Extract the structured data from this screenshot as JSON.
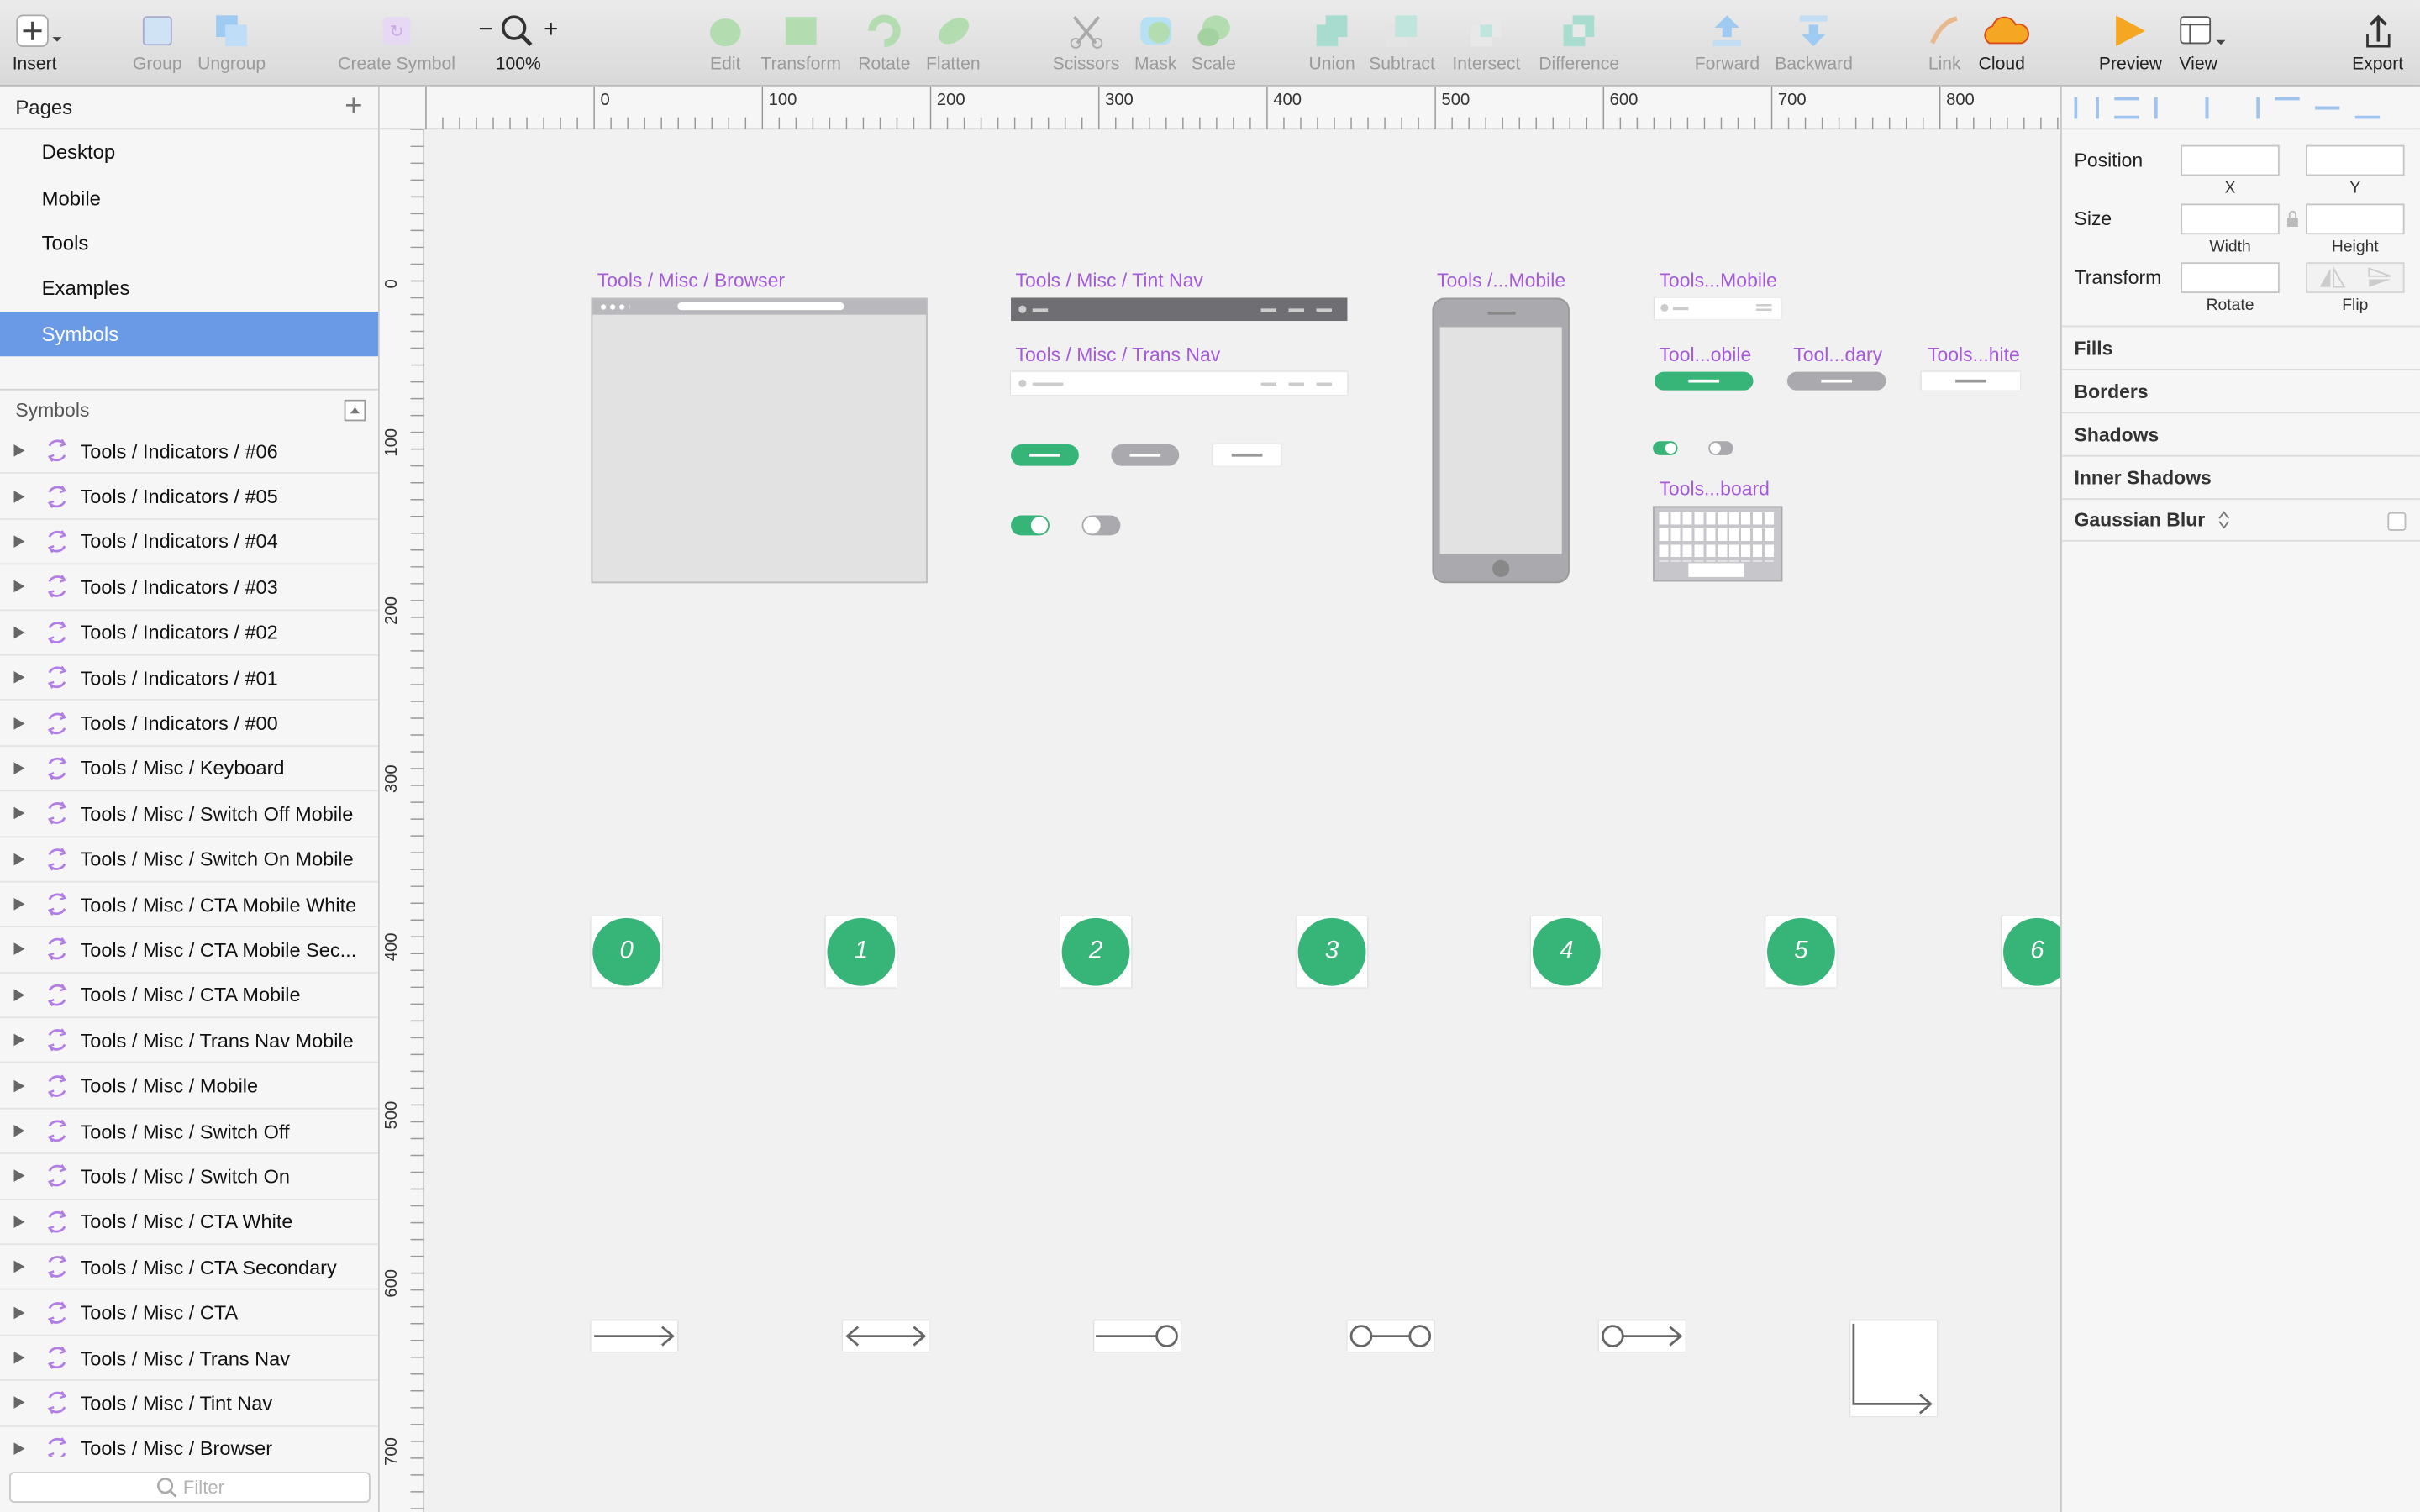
{
  "toolbar": {
    "insert": "Insert",
    "group": "Group",
    "ungroup": "Ungroup",
    "create_symbol": "Create Symbol",
    "zoom_minus": "−",
    "zoom_plus": "+",
    "zoom": "100%",
    "edit": "Edit",
    "transform": "Transform",
    "rotate": "Rotate",
    "flatten": "Flatten",
    "scissors": "Scissors",
    "mask": "Mask",
    "scale": "Scale",
    "union": "Union",
    "subtract": "Subtract",
    "intersect": "Intersect",
    "difference": "Difference",
    "forward": "Forward",
    "backward": "Backward",
    "link": "Link",
    "cloud": "Cloud",
    "preview": "Preview",
    "view": "View",
    "export": "Export"
  },
  "pages": {
    "title": "Pages",
    "add": "+",
    "items": [
      "Desktop",
      "Mobile",
      "Tools",
      "Examples",
      "Symbols"
    ],
    "selected": "Symbols"
  },
  "symbols_panel": {
    "title": "Symbols",
    "items": [
      "Tools / Indicators / #06",
      "Tools / Indicators / #05",
      "Tools / Indicators / #04",
      "Tools / Indicators / #03",
      "Tools / Indicators / #02",
      "Tools / Indicators / #01",
      "Tools / Indicators / #00",
      "Tools / Misc / Keyboard",
      "Tools / Misc / Switch Off Mobile",
      "Tools / Misc / Switch On Mobile",
      "Tools / Misc / CTA Mobile White",
      "Tools / Misc / CTA Mobile Sec...",
      "Tools / Misc / CTA Mobile",
      "Tools / Misc / Trans Nav Mobile",
      "Tools / Misc / Mobile",
      "Tools / Misc / Switch Off",
      "Tools / Misc / Switch On",
      "Tools / Misc / CTA White",
      "Tools / Misc / CTA Secondary",
      "Tools / Misc / CTA",
      "Tools / Misc / Trans Nav",
      "Tools / Misc / Tint Nav",
      "Tools / Misc / Browser"
    ],
    "filter_placeholder": "Filter"
  },
  "rulers": {
    "horizontal": [
      "0",
      "100",
      "200",
      "300",
      "400",
      "500",
      "600",
      "700",
      "800"
    ],
    "vertical": [
      "0",
      "100",
      "200",
      "300",
      "400",
      "500",
      "600",
      "700"
    ]
  },
  "canvas": {
    "artboards": {
      "browser": "Tools / Misc / Browser",
      "tint_nav": "Tools / Misc / Tint Nav",
      "trans_nav": "Tools / Misc / Trans Nav",
      "mobile": "Tools /...Mobile",
      "trans_nav_mobile": "Tools...Mobile",
      "cta_mobile": "Tool...obile",
      "cta_mobile_secondary": "Tool...dary",
      "cta_mobile_white": "Tools...hite",
      "keyboard": "Tools...board"
    },
    "indicators": [
      "0",
      "1",
      "2",
      "3",
      "4",
      "5",
      "6"
    ]
  },
  "inspector": {
    "position": "Position",
    "x": "X",
    "y": "Y",
    "size": "Size",
    "width": "Width",
    "height": "Height",
    "transform": "Transform",
    "rotate": "Rotate",
    "flip": "Flip",
    "sections": [
      "Fills",
      "Borders",
      "Shadows",
      "Inner Shadows",
      "Gaussian Blur"
    ]
  },
  "colors": {
    "accent_green": "#37b477",
    "artboard_label": "#a45bd8",
    "selection": "#6a9ae6"
  }
}
